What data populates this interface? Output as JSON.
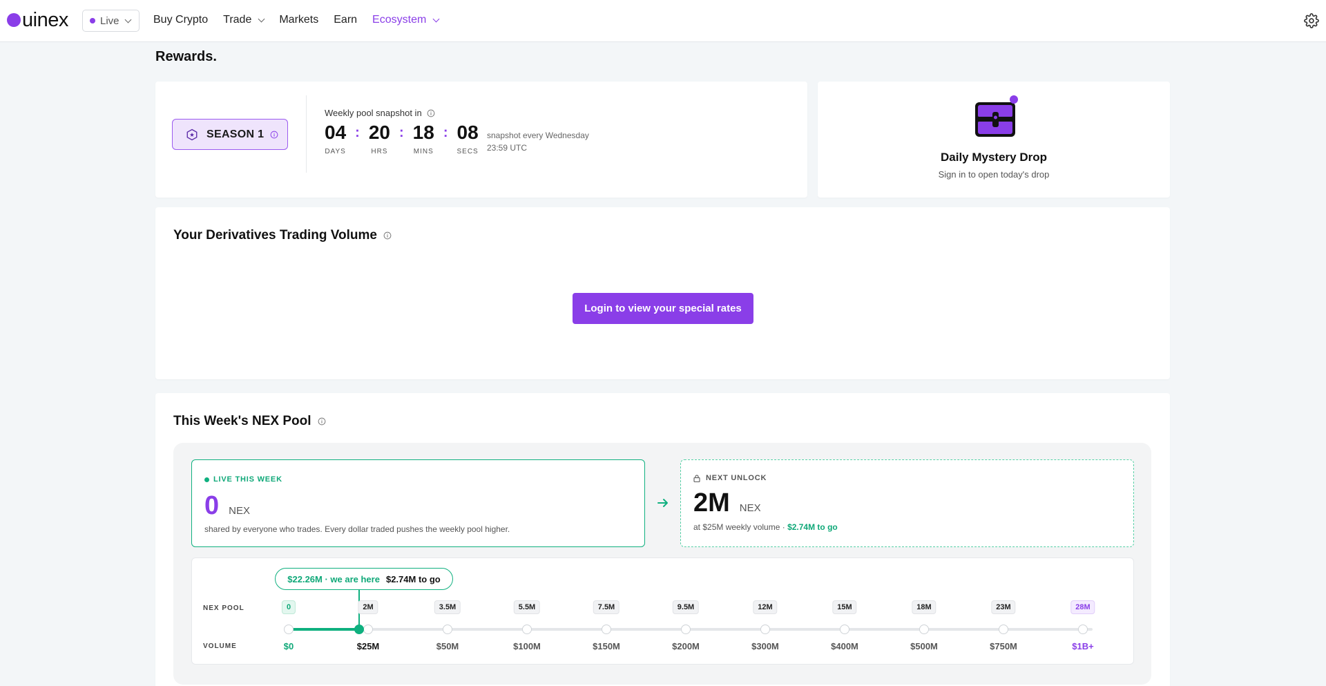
{
  "header": {
    "logo_text": "uinex",
    "mode": "Live",
    "nav": [
      {
        "label": "Buy Crypto",
        "dropdown": false
      },
      {
        "label": "Trade",
        "dropdown": true
      },
      {
        "label": "Markets",
        "dropdown": false
      },
      {
        "label": "Earn",
        "dropdown": false
      },
      {
        "label": "Ecosystem",
        "dropdown": true,
        "active": true
      }
    ],
    "settings_icon": "gear-icon"
  },
  "page": {
    "title": "Rewards."
  },
  "season": {
    "badge": "SEASON 1",
    "snapshot_label": "Weekly pool snapshot in",
    "countdown": [
      {
        "value": "04",
        "label": "DAYS"
      },
      {
        "value": "20",
        "label": "HRS"
      },
      {
        "value": "18",
        "label": "MINS"
      },
      {
        "value": "08",
        "label": "SECS"
      }
    ],
    "note_line1": "snapshot every Wednesday",
    "note_line2": "23:59 UTC"
  },
  "mystery": {
    "title": "Daily Mystery Drop",
    "subtitle": "Sign in to open today's drop"
  },
  "volume": {
    "title": "Your Derivatives Trading Volume",
    "login_button": "Login to view your special rates"
  },
  "pool": {
    "title": "This Week's NEX Pool",
    "live": {
      "tag": "LIVE THIS WEEK",
      "value": "0",
      "unit": "NEX",
      "desc": "shared by everyone who trades. Every dollar traded pushes the weekly pool higher."
    },
    "next": {
      "tag": "NEXT UNLOCK",
      "value": "2M",
      "unit": "NEX",
      "desc_prefix": "at $25M weekly volume · ",
      "desc_highlight": "$2.74M to go"
    },
    "here_pill": {
      "current": "$22.26M · we are here",
      "to_go": "$2.74M to go"
    },
    "progress_fraction": 0.89,
    "row_labels": {
      "pool": "NEX POOL",
      "volume": "VOLUME"
    },
    "tiers": [
      {
        "pool": "0",
        "volume": "$0"
      },
      {
        "pool": "2M",
        "volume": "$25M"
      },
      {
        "pool": "3.5M",
        "volume": "$50M"
      },
      {
        "pool": "5.5M",
        "volume": "$100M"
      },
      {
        "pool": "7.5M",
        "volume": "$150M"
      },
      {
        "pool": "9.5M",
        "volume": "$200M"
      },
      {
        "pool": "12M",
        "volume": "$300M"
      },
      {
        "pool": "15M",
        "volume": "$400M"
      },
      {
        "pool": "18M",
        "volume": "$500M"
      },
      {
        "pool": "23M",
        "volume": "$750M"
      },
      {
        "pool": "28M",
        "volume": "$1B+"
      }
    ]
  },
  "colors": {
    "accent": "#8a3ee8",
    "success": "#0fb07f",
    "background": "#f3f6f8"
  }
}
